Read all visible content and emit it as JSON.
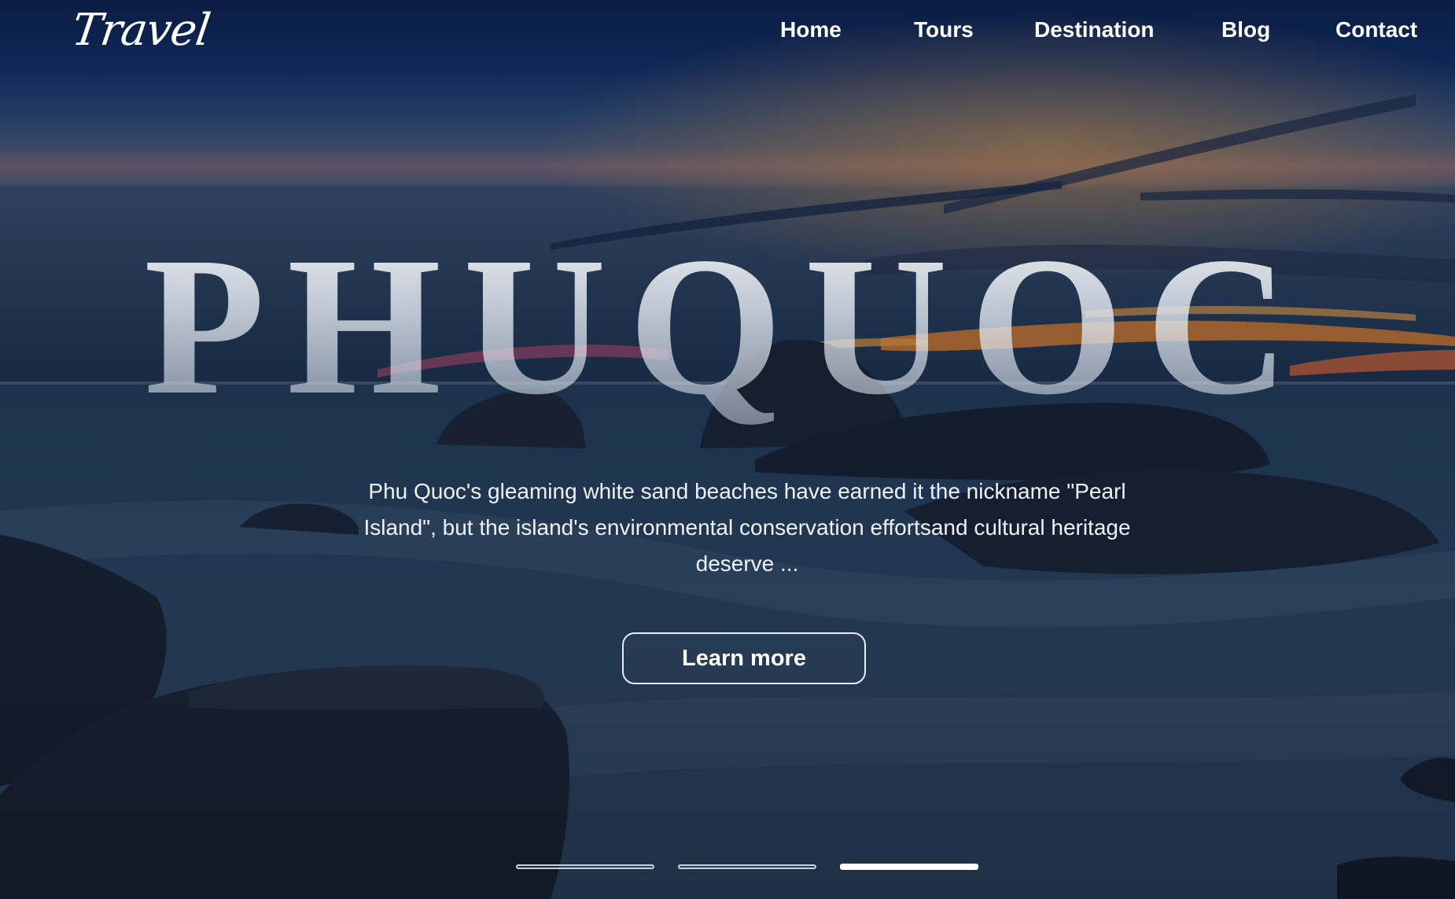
{
  "brand": {
    "logo_text": "Travel"
  },
  "nav": {
    "items": [
      "Home",
      "Tours",
      "Destination",
      "Blog",
      "Contact"
    ]
  },
  "hero": {
    "title": "PHUQUOC",
    "description": "Phu Quoc's gleaming white sand beaches have earned it the nickname \"Pearl Island\", but the island's environmental conservation effortsand cultural heritage deserve ...",
    "cta_label": "Learn more"
  },
  "carousel": {
    "slide_count": 3,
    "active_index": 2
  },
  "colors": {
    "sky_top": "#0a1f4a",
    "sunset_orange": "#e8862d",
    "sunset_pink": "#d2507a",
    "sea": "#2a4663",
    "rock": "#1b2535",
    "text": "#ffffff"
  }
}
